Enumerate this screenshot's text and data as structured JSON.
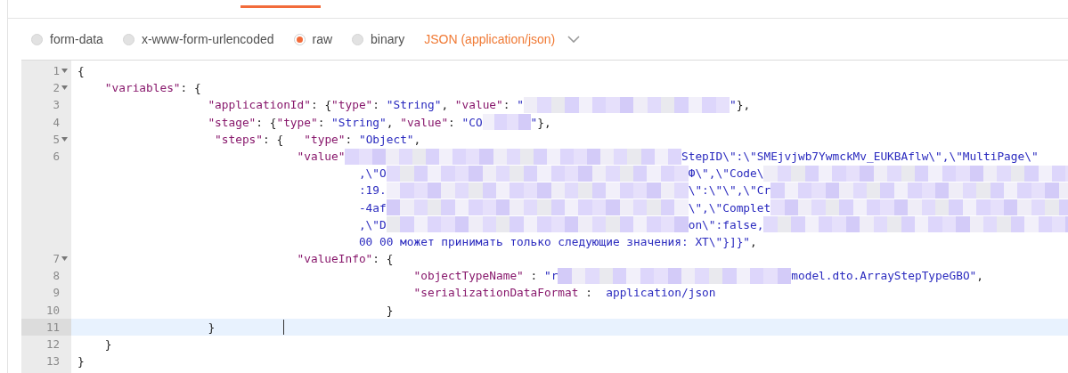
{
  "body_types": [
    {
      "label": "form-data",
      "selected": false
    },
    {
      "label": "x-www-form-urlencoded",
      "selected": false
    },
    {
      "label": "raw",
      "selected": true
    },
    {
      "label": "binary",
      "selected": false
    }
  ],
  "format_dropdown": {
    "label": "JSON (application/json)"
  },
  "editor": {
    "rows": [
      {
        "number": "1",
        "foldable": true,
        "active": false,
        "segments": [
          {
            "kind": "code",
            "tokens": [
              {
                "kind": "punct",
                "text": "{"
              }
            ]
          }
        ]
      },
      {
        "number": "2",
        "foldable": true,
        "active": false,
        "segments": [
          {
            "kind": "code",
            "tokens": [
              {
                "kind": "key",
                "text": "    \"variables\""
              },
              {
                "kind": "punct",
                "text": ": {"
              }
            ]
          }
        ]
      },
      {
        "number": "3",
        "foldable": false,
        "active": false,
        "segments": [
          {
            "kind": "code",
            "tokens": [
              {
                "kind": "key",
                "text": "                   \"applicationId\""
              },
              {
                "kind": "punct",
                "text": ": {"
              },
              {
                "kind": "key",
                "text": "\"type\""
              },
              {
                "kind": "punct",
                "text": ": "
              },
              {
                "kind": "string",
                "text": "\"String\""
              },
              {
                "kind": "punct",
                "text": ", "
              },
              {
                "kind": "key",
                "text": "\"value\""
              },
              {
                "kind": "punct",
                "text": ": "
              },
              {
                "kind": "string",
                "text": "\""
              }
            ]
          },
          {
            "kind": "redacted"
          },
          {
            "kind": "code",
            "tokens": [
              {
                "kind": "string",
                "text": "\""
              },
              {
                "kind": "punct",
                "text": "},"
              }
            ]
          }
        ]
      },
      {
        "number": "4",
        "foldable": false,
        "active": false,
        "segments": [
          {
            "kind": "code",
            "tokens": [
              {
                "kind": "key",
                "text": "                   \"stage\""
              },
              {
                "kind": "punct",
                "text": ": {"
              },
              {
                "kind": "key",
                "text": "\"type\""
              },
              {
                "kind": "punct",
                "text": ": "
              },
              {
                "kind": "string",
                "text": "\"String\""
              },
              {
                "kind": "punct",
                "text": ", "
              },
              {
                "kind": "key",
                "text": "\"value\""
              },
              {
                "kind": "punct",
                "text": ": "
              },
              {
                "kind": "string",
                "text": "\"CO"
              }
            ]
          },
          {
            "kind": "redacted"
          },
          {
            "kind": "code",
            "tokens": [
              {
                "kind": "string",
                "text": "\""
              },
              {
                "kind": "punct",
                "text": "},"
              }
            ]
          }
        ]
      },
      {
        "number": "5",
        "foldable": true,
        "active": false,
        "segments": [
          {
            "kind": "code",
            "tokens": [
              {
                "kind": "key",
                "text": "                    \"steps\""
              },
              {
                "kind": "punct",
                "text": ": {   "
              },
              {
                "kind": "key",
                "text": "\"type\""
              },
              {
                "kind": "punct",
                "text": ": "
              },
              {
                "kind": "string",
                "text": "\"Object\""
              },
              {
                "kind": "punct",
                "text": ","
              }
            ]
          }
        ]
      },
      {
        "number": "6",
        "foldable": false,
        "active": false,
        "segments": [
          {
            "kind": "code",
            "tokens": [
              {
                "kind": "key",
                "text": "                                \"value\""
              }
            ]
          },
          {
            "kind": "redacted"
          },
          {
            "kind": "code",
            "tokens": [
              {
                "kind": "string",
                "text": "StepID\\\":\\\"SMEjvjwb7YwmckMv_EUKBAflw\\\",\\\"MultiPage\\\""
              }
            ]
          }
        ]
      },
      {
        "foldable": false,
        "active": false,
        "segments": [
          {
            "kind": "code",
            "tokens": [
              {
                "kind": "string",
                "text": "                                         ,\\\"O"
              }
            ]
          },
          {
            "kind": "redacted"
          },
          {
            "kind": "code",
            "tokens": [
              {
                "kind": "string",
                "text": "Ф\\\",\\\"Code\\"
              }
            ]
          },
          {
            "kind": "redacted"
          }
        ]
      },
      {
        "foldable": false,
        "active": false,
        "segments": [
          {
            "kind": "code",
            "tokens": [
              {
                "kind": "string",
                "text": "                                         :19."
              }
            ]
          },
          {
            "kind": "redacted"
          },
          {
            "kind": "code",
            "tokens": [
              {
                "kind": "string",
                "text": "\\\":\\\"\\\",\\\"Cr"
              }
            ]
          },
          {
            "kind": "redacted"
          }
        ]
      },
      {
        "foldable": false,
        "active": false,
        "segments": [
          {
            "kind": "code",
            "tokens": [
              {
                "kind": "string",
                "text": "                                         -4af"
              }
            ]
          },
          {
            "kind": "redacted"
          },
          {
            "kind": "code",
            "tokens": [
              {
                "kind": "string",
                "text": "\\\",\\\"Complet"
              }
            ]
          },
          {
            "kind": "redacted"
          }
        ]
      },
      {
        "foldable": false,
        "active": false,
        "segments": [
          {
            "kind": "code",
            "tokens": [
              {
                "kind": "string",
                "text": "                                         ,\\\"D"
              }
            ]
          },
          {
            "kind": "redacted"
          },
          {
            "kind": "code",
            "tokens": [
              {
                "kind": "string",
                "text": "on\\\":false,"
              }
            ]
          },
          {
            "kind": "redacted"
          }
        ]
      },
      {
        "foldable": false,
        "active": false,
        "segments": [
          {
            "kind": "code",
            "tokens": [
              {
                "kind": "string",
                "text": "                                         00 00 может принимать только следующие значения: XT\\\"}]}\""
              },
              {
                "kind": "punct",
                "text": ","
              }
            ]
          }
        ]
      },
      {
        "number": "7",
        "foldable": true,
        "active": false,
        "segments": [
          {
            "kind": "code",
            "tokens": [
              {
                "kind": "key",
                "text": "                                \"valueInfo\""
              },
              {
                "kind": "punct",
                "text": ": {"
              }
            ]
          }
        ]
      },
      {
        "number": "8",
        "foldable": false,
        "active": false,
        "segments": [
          {
            "kind": "code",
            "tokens": [
              {
                "kind": "key",
                "text": "                                                 \"objectTypeName\""
              },
              {
                "kind": "punct",
                "text": " : "
              },
              {
                "kind": "string",
                "text": "\"r"
              }
            ]
          },
          {
            "kind": "redacted"
          },
          {
            "kind": "code",
            "tokens": [
              {
                "kind": "string",
                "text": "model.dto.ArrayStepTypeGBO\""
              },
              {
                "kind": "punct",
                "text": ","
              }
            ]
          }
        ]
      },
      {
        "number": "9",
        "foldable": false,
        "active": false,
        "segments": [
          {
            "kind": "code",
            "tokens": [
              {
                "kind": "key",
                "text": "                                                 \"serializationDataFormat"
              },
              {
                "kind": "punct",
                "text": " :  "
              },
              {
                "kind": "string",
                "text": "application/json"
              }
            ]
          }
        ]
      },
      {
        "number": "10",
        "foldable": false,
        "active": false,
        "segments": [
          {
            "kind": "code",
            "tokens": [
              {
                "kind": "punct",
                "text": "                                             }"
              }
            ]
          }
        ]
      },
      {
        "number": "11",
        "foldable": false,
        "active": true,
        "segments": [
          {
            "kind": "code",
            "tokens": [
              {
                "kind": "punct",
                "text": "                   }"
              }
            ]
          }
        ]
      },
      {
        "number": "12",
        "foldable": false,
        "active": false,
        "segments": [
          {
            "kind": "code",
            "tokens": [
              {
                "kind": "punct",
                "text": "    }"
              }
            ]
          }
        ]
      },
      {
        "number": "13",
        "foldable": false,
        "active": false,
        "segments": [
          {
            "kind": "code",
            "tokens": [
              {
                "kind": "punct",
                "text": "}"
              }
            ]
          }
        ]
      }
    ]
  }
}
